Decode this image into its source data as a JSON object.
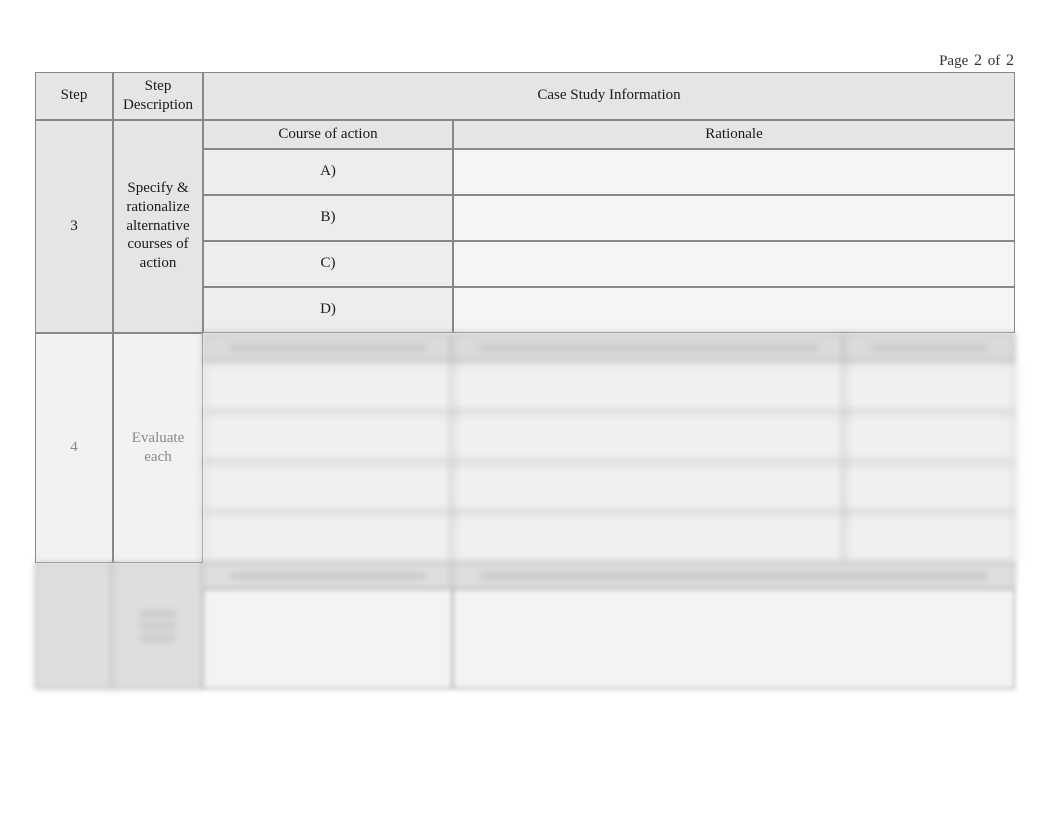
{
  "page": {
    "label": "Page",
    "current": "2",
    "of_label": "of",
    "total": "2"
  },
  "headers": {
    "step": "Step",
    "step_description": "Step Description",
    "case_study_info": "Case Study Information"
  },
  "step3": {
    "number": "3",
    "description": "Specify & rationalize alternative courses of action",
    "sub": {
      "course_of_action": "Course of action",
      "rationale": "Rationale"
    },
    "rows": {
      "a": "A)",
      "b": "B)",
      "c": "C)",
      "d": "D)"
    }
  },
  "step4": {
    "number": "4",
    "description": "Evaluate each"
  },
  "step5": {
    "number": ""
  }
}
